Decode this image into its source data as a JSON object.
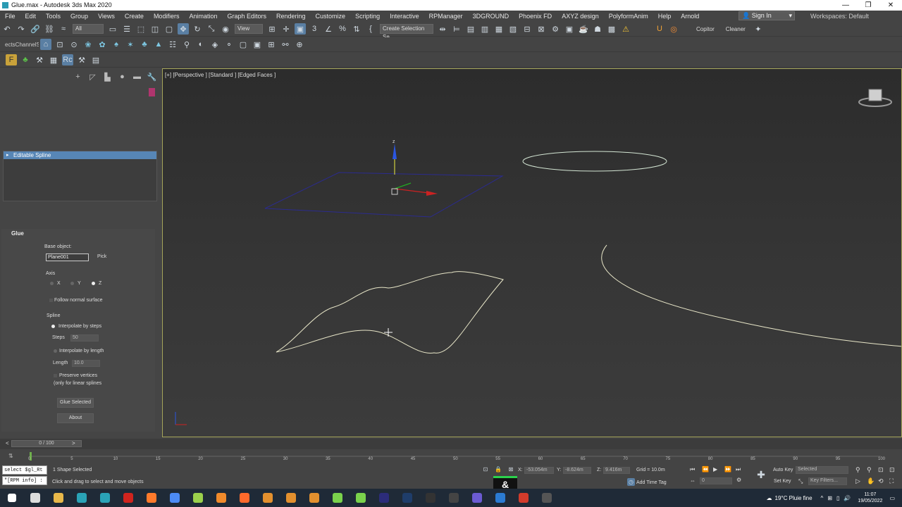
{
  "window": {
    "title": "Glue.max - Autodesk 3ds Max 2020",
    "controls": [
      "—",
      "❐",
      "✕"
    ]
  },
  "menu": {
    "items": [
      "File",
      "Edit",
      "Tools",
      "Group",
      "Views",
      "Create",
      "Modifiers",
      "Animation",
      "Graph Editors",
      "Rendering",
      "Customize",
      "Scripting",
      "Interactive",
      "RPManager",
      "3DGROUND",
      "Phoenix FD",
      "AXYZ design",
      "PolyformAnim",
      "Help",
      "Arnold"
    ],
    "sign_in": "Sign In",
    "workspaces": "Workspaces: Default"
  },
  "toolbar": {
    "selection_filter": "All",
    "ref_coord": "View",
    "create_selection_set": "Create Selection Se",
    "copitor": "Copitor",
    "cleaner": "Cleaner",
    "channels_label": "ectsChannelS"
  },
  "modifier_stack": {
    "selected_item": "Editable Spline"
  },
  "glue_rollout": {
    "title": "Glue",
    "base_object_label": "Base object:",
    "base_object_value": "Plane001",
    "pick_label": "Pick",
    "axis_label": "Axis",
    "axis_options": [
      "X",
      "Y",
      "Z"
    ],
    "axis_selected": "Z",
    "follow_normal_label": "Follow normal surface",
    "spline_label": "Spline",
    "interpolate_steps_label": "Interpolate by steps",
    "steps_label": "Steps",
    "steps_value": "50",
    "interpolate_length_label": "Interpolate by length",
    "length_label": "Length",
    "length_value": "10.0",
    "preserve_label": "Preserve vertices",
    "preserve_sub": "(only for linear splines",
    "glue_selected_label": "Glue Selected",
    "about_label": "About"
  },
  "viewport": {
    "label": "[+] [Perspective ] [Standard ] [Edged Faces ]",
    "gizmo_axis_label": "z"
  },
  "timeline": {
    "frame_display": "0 / 100",
    "ticks": [
      "0",
      "5",
      "10",
      "15",
      "20",
      "25",
      "30",
      "35",
      "40",
      "45",
      "50",
      "55",
      "60",
      "65",
      "70",
      "75",
      "80",
      "85",
      "90",
      "95",
      "100"
    ]
  },
  "status": {
    "script_line1": "select $gl_Rt",
    "script_line2": "\"[RPM info] :",
    "selection_info": "1 Shape Selected",
    "prompt": "Click and drag to select and move objects",
    "x_label": "X:",
    "x_value": "-53.054m",
    "y_label": "Y:",
    "y_value": "-8.624m",
    "z_label": "Z:",
    "z_value": "9.416m",
    "grid": "Grid = 10.0m",
    "add_time_tag": "Add Time Tag",
    "auto_key": "Auto Key",
    "set_key": "Set Key",
    "selected_dropdown": "Selected",
    "key_filters": "Key Filters...",
    "frame_field": "0"
  },
  "taskbar": {
    "weather": "19°C  Pluie fine",
    "time": "11:07",
    "date": "19/05/2022",
    "apps": [
      {
        "name": "search-app",
        "color": "#dddddd"
      },
      {
        "name": "explorer-app",
        "color": "#e8b84a"
      },
      {
        "name": "3dsmax-app",
        "color": "#2aa3b7"
      },
      {
        "name": "3dsmax-active-app",
        "color": "#2aa3b7"
      },
      {
        "name": "acrobat-app",
        "color": "#d0241e"
      },
      {
        "name": "firefox-app",
        "color": "#ff7a2b"
      },
      {
        "name": "chrome-app",
        "color": "#4c8bf5"
      },
      {
        "name": "notepad-app",
        "color": "#9bd04c"
      },
      {
        "name": "blender-app",
        "color": "#f08a2b"
      },
      {
        "name": "houdini-app",
        "color": "#ff6a2b"
      },
      {
        "name": "tool-app-1",
        "color": "#e3902e"
      },
      {
        "name": "tool-app-2",
        "color": "#e3902e"
      },
      {
        "name": "tool-app-3",
        "color": "#e3902e"
      },
      {
        "name": "tool-app-4",
        "color": "#7ad24c"
      },
      {
        "name": "tool-app-5",
        "color": "#7ad24c"
      },
      {
        "name": "aftereffects-app",
        "color": "#2c2c7a"
      },
      {
        "name": "photoshop-app",
        "color": "#1f3d6a"
      },
      {
        "name": "epic-app",
        "color": "#333333"
      },
      {
        "name": "obs-app",
        "color": "#444444"
      },
      {
        "name": "tool-app-6",
        "color": "#6b5bd2"
      },
      {
        "name": "tool-app-7",
        "color": "#2b7bd2"
      },
      {
        "name": "tool-app-8",
        "color": "#d23b2b"
      },
      {
        "name": "capture-app",
        "color": "#555555"
      }
    ]
  },
  "colors": {
    "selection_blue": "#5786b6",
    "viewport_border": "#a5a55a",
    "spline_color": "#e8e6c8",
    "object_color": "#b0356e"
  }
}
